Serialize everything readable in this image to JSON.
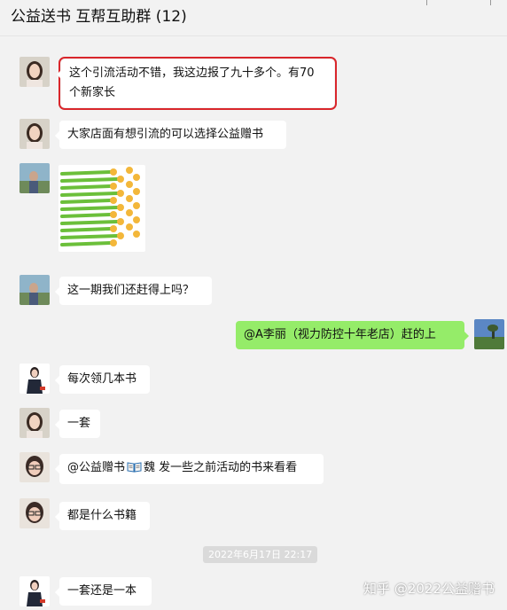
{
  "header": {
    "title": "公益送书 互帮互助群 (12)"
  },
  "messages": [
    {
      "side": "left",
      "sender": "female-avatar",
      "text": "这个引流活动不错，我这边报了九十多个。有70\n个新家长",
      "highlighted": true
    },
    {
      "side": "left",
      "sender": "female-avatar",
      "text": "大家店面有想引流的可以选择公益赠书"
    },
    {
      "side": "left",
      "sender": "outdoor-avatar",
      "type": "sticker",
      "sticker": "thumbs-up-sticker-grid"
    },
    {
      "side": "left",
      "sender": "outdoor-avatar",
      "text": "这一期我们还赶得上吗？"
    },
    {
      "side": "right",
      "sender": "landscape-avatar",
      "text": "@A李丽（视力防控十年老店）赶的上"
    },
    {
      "side": "left",
      "sender": "suit-avatar",
      "text": "每次领几本书"
    },
    {
      "side": "left",
      "sender": "female-avatar",
      "text": "一套"
    },
    {
      "side": "left",
      "sender": "glasses-avatar",
      "mention": "@公益赠书",
      "text_after": "魏 发一些之前活动的书来看看"
    },
    {
      "side": "left",
      "sender": "glasses-avatar",
      "text": "都是什么书籍"
    },
    {
      "side": "left",
      "sender": "suit-avatar",
      "text": "一套还是一本"
    }
  ],
  "timestamp": "2022年6月17日 22:17",
  "watermark": "知乎 @2022公益赠书",
  "colors": {
    "background": "#f2f2f2",
    "bubble_left": "#ffffff",
    "bubble_right": "#95ec69",
    "highlight": "#d9262b"
  },
  "icons": [
    "book-icon"
  ]
}
